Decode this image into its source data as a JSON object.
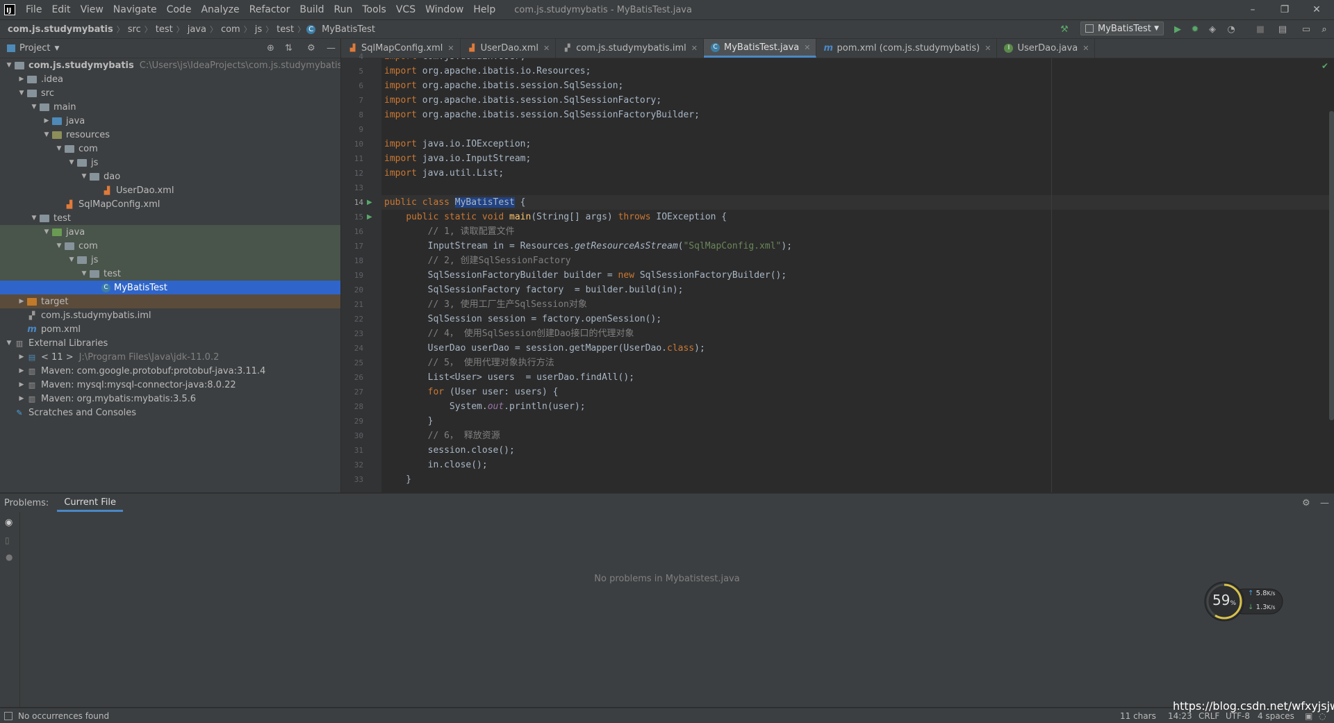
{
  "window": {
    "logo": "IJ",
    "menu": [
      "File",
      "Edit",
      "View",
      "Navigate",
      "Code",
      "Analyze",
      "Refactor",
      "Build",
      "Run",
      "Tools",
      "VCS",
      "Window",
      "Help"
    ],
    "title": "com.js.studymybatis - MyBatisTest.java",
    "controls": [
      "–",
      "❐",
      "✕"
    ]
  },
  "breadcrumb": [
    "com.js.studymybatis",
    "src",
    "test",
    "java",
    "com",
    "js",
    "test",
    "MyBatisTest"
  ],
  "run_config": {
    "label": "MyBatisTest"
  },
  "project_panel": {
    "title": "Project",
    "tree": [
      {
        "label": "com.js.studymybatis",
        "hint": "C:\\Users\\js\\IdeaProjects\\com.js.studymybatis",
        "indent": 0,
        "arrow": "down",
        "icon": "folder",
        "bold": true
      },
      {
        "label": ".idea",
        "indent": 1,
        "arrow": "right",
        "icon": "folder"
      },
      {
        "label": "src",
        "indent": 1,
        "arrow": "down",
        "icon": "folder"
      },
      {
        "label": "main",
        "indent": 2,
        "arrow": "down",
        "icon": "folder"
      },
      {
        "label": "java",
        "indent": 3,
        "arrow": "right",
        "icon": "folder-blue"
      },
      {
        "label": "resources",
        "indent": 3,
        "arrow": "down",
        "icon": "folder-res"
      },
      {
        "label": "com",
        "indent": 4,
        "arrow": "down",
        "icon": "folder"
      },
      {
        "label": "js",
        "indent": 5,
        "arrow": "down",
        "icon": "folder"
      },
      {
        "label": "dao",
        "indent": 6,
        "arrow": "down",
        "icon": "folder"
      },
      {
        "label": "UserDao.xml",
        "indent": 7,
        "arrow": "",
        "icon": "xml"
      },
      {
        "label": "SqlMapConfig.xml",
        "indent": 4,
        "arrow": "",
        "icon": "xml"
      },
      {
        "label": "test",
        "indent": 2,
        "arrow": "down",
        "icon": "folder"
      },
      {
        "label": "java",
        "indent": 3,
        "arrow": "down",
        "icon": "folder-green",
        "row": "test"
      },
      {
        "label": "com",
        "indent": 4,
        "arrow": "down",
        "icon": "folder",
        "row": "test"
      },
      {
        "label": "js",
        "indent": 5,
        "arrow": "down",
        "icon": "folder",
        "row": "test"
      },
      {
        "label": "test",
        "indent": 6,
        "arrow": "down",
        "icon": "folder",
        "row": "test"
      },
      {
        "label": "MyBatisTest",
        "indent": 7,
        "arrow": "",
        "icon": "class",
        "row": "selected"
      },
      {
        "label": "target",
        "indent": 1,
        "arrow": "right",
        "icon": "folder-orange",
        "row": "target"
      },
      {
        "label": "com.js.studymybatis.iml",
        "indent": 1,
        "arrow": "",
        "icon": "iml"
      },
      {
        "label": "pom.xml",
        "indent": 1,
        "arrow": "",
        "icon": "maven"
      },
      {
        "label": "External Libraries",
        "indent": 0,
        "arrow": "down",
        "icon": "lib"
      },
      {
        "label": "< 11 >",
        "hint": "J:\\Program Files\\Java\\jdk-11.0.2",
        "indent": 1,
        "arrow": "right",
        "icon": "jdk"
      },
      {
        "label": "Maven: com.google.protobuf:protobuf-java:3.11.4",
        "indent": 1,
        "arrow": "right",
        "icon": "lib"
      },
      {
        "label": "Maven: mysql:mysql-connector-java:8.0.22",
        "indent": 1,
        "arrow": "right",
        "icon": "lib"
      },
      {
        "label": "Maven: org.mybatis:mybatis:3.5.6",
        "indent": 1,
        "arrow": "right",
        "icon": "lib"
      },
      {
        "label": "Scratches and Consoles",
        "indent": 0,
        "arrow": "",
        "icon": "scratch"
      }
    ]
  },
  "tabs": [
    {
      "label": "SqlMapConfig.xml",
      "icon": "xml",
      "active": false
    },
    {
      "label": "UserDao.xml",
      "icon": "xml",
      "active": false
    },
    {
      "label": "com.js.studymybatis.iml",
      "icon": "iml",
      "active": false
    },
    {
      "label": "MyBatisTest.java",
      "icon": "class",
      "active": true
    },
    {
      "label": "pom.xml (com.js.studymybatis)",
      "icon": "maven",
      "active": false
    },
    {
      "label": "UserDao.java",
      "icon": "interface",
      "active": false
    }
  ],
  "editor": {
    "lines": [
      {
        "n": "4",
        "html": "<span class=\"kw\">import</span> com.js.domain.User;"
      },
      {
        "n": "5",
        "html": "<span class=\"kw\">import</span> org.apache.ibatis.io.Resources;"
      },
      {
        "n": "6",
        "html": "<span class=\"kw\">import</span> org.apache.ibatis.session.SqlSession;"
      },
      {
        "n": "7",
        "html": "<span class=\"kw\">import</span> org.apache.ibatis.session.SqlSessionFactory;"
      },
      {
        "n": "8",
        "html": "<span class=\"kw\">import</span> org.apache.ibatis.session.SqlSessionFactoryBuilder;"
      },
      {
        "n": "9",
        "html": ""
      },
      {
        "n": "10",
        "html": "<span class=\"kw\">import</span> java.io.IOException;"
      },
      {
        "n": "11",
        "html": "<span class=\"kw\">import</span> java.io.InputStream;"
      },
      {
        "n": "12",
        "html": "<span class=\"kw\">import</span> java.util.List;"
      },
      {
        "n": "13",
        "html": ""
      },
      {
        "n": "14",
        "html": "<span class=\"kw\">public class</span> <span class=\"hl\">MyBatisTest</span> {",
        "current": true,
        "run": true
      },
      {
        "n": "15",
        "html": "    <span class=\"kw\">public static void</span> <span class=\"fn\">main</span>(String[] args) <span class=\"kw\">throws</span> IOException {",
        "run": true
      },
      {
        "n": "16",
        "html": "        <span class=\"cmt\">// 1, 读取配置文件</span>"
      },
      {
        "n": "17",
        "html": "        InputStream in = Resources.<span class=\"it\">getResourceAsStream</span>(<span class=\"str\">\"SqlMapConfig.xml\"</span>);"
      },
      {
        "n": "18",
        "html": "        <span class=\"cmt\">// 2, 创建SqlSessionFactory</span>"
      },
      {
        "n": "19",
        "html": "        SqlSessionFactoryBuilder builder = <span class=\"kw\">new</span> SqlSessionFactoryBuilder();"
      },
      {
        "n": "20",
        "html": "        SqlSessionFactory factory  = builder.build(in);"
      },
      {
        "n": "21",
        "html": "        <span class=\"cmt\">// 3, 使用工厂生产SqlSession对象</span>"
      },
      {
        "n": "22",
        "html": "        SqlSession session = factory.openSession();"
      },
      {
        "n": "23",
        "html": "        <span class=\"cmt\">// 4， 使用SqlSession创建Dao接口的代理对象</span>"
      },
      {
        "n": "24",
        "html": "        UserDao userDao = session.getMapper(UserDao.<span class=\"kw\">class</span>);"
      },
      {
        "n": "25",
        "html": "        <span class=\"cmt\">// 5， 使用代理对象执行方法</span>"
      },
      {
        "n": "26",
        "html": "        List&lt;User&gt; users  = userDao.findAll();"
      },
      {
        "n": "27",
        "html": "        <span class=\"kw\">for</span> (User user: users) {"
      },
      {
        "n": "28",
        "html": "            System.<span class=\"stat\">out</span>.println(user);"
      },
      {
        "n": "29",
        "html": "        }"
      },
      {
        "n": "30",
        "html": "        <span class=\"cmt\">// 6， 释放资源</span>"
      },
      {
        "n": "31",
        "html": "        session.close();"
      },
      {
        "n": "32",
        "html": "        in.close();"
      },
      {
        "n": "33",
        "html": "    }"
      }
    ]
  },
  "problems": {
    "label": "Problems:",
    "tab": "Current File",
    "empty_message": "No problems in Mybatistest.java"
  },
  "status": {
    "left": "No occurrences found",
    "chars": "11 chars",
    "position": "14:23",
    "line_sep": "CRLF",
    "encoding": "UTF-8",
    "indent": "4 spaces"
  },
  "gauge": {
    "percent": "59",
    "unit": "%",
    "up": "5.8",
    "down": "1.3",
    "rate_unit": "K/s",
    "fraction": 0.59
  },
  "watermark": "https://blog.csdn.net/wfxyjsjwjs",
  "colors": {
    "accent": "#4a88c7",
    "selection": "#2f65ca",
    "run": "#59a869",
    "panel": "#3c3f41",
    "editor": "#2b2b2b"
  }
}
